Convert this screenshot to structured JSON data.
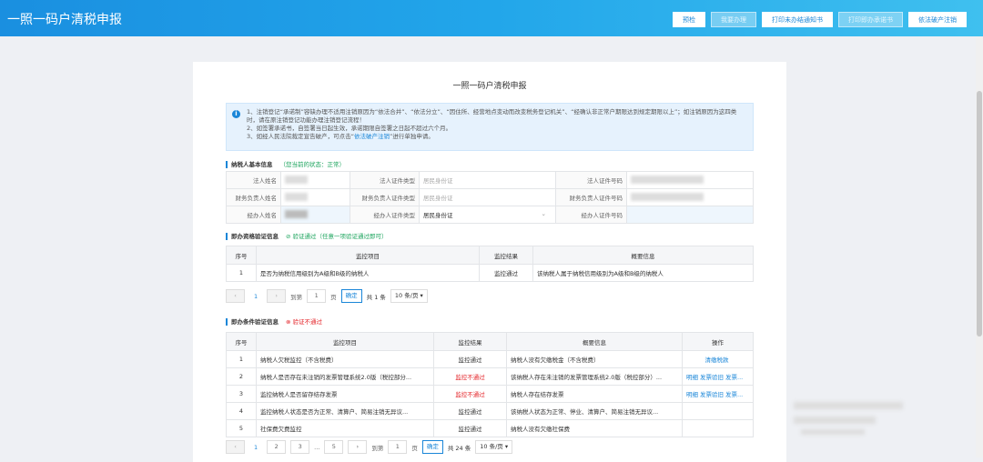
{
  "header": {
    "title": "一照一码户清税申报",
    "buttons": [
      {
        "label": "预检",
        "disabled": false
      },
      {
        "label": "我要办理",
        "disabled": true
      },
      {
        "label": "打印未办结通知书",
        "disabled": false
      },
      {
        "label": "打印即办承诺书",
        "disabled": true
      },
      {
        "label": "依法破产注销",
        "disabled": false
      }
    ]
  },
  "card": {
    "title": "一照一码户清税申报",
    "notice": {
      "line1": "1、注销登记“承诺制”容缺办理不适用注销原因为“依法合并”、“依法分立”、“因住所、经营地点变动而改变税务登记机关”、“经确认非正常户期限达到规定期限以上”；如注销原因为这四类时，请在原注销登记功能办理注销登记流程！",
      "line2": "2、如签署承诺书，自签署当日起生效，承诺期限自签署之日起不超过六个月。",
      "line3_pre": "3、如经人民法院裁定宣告破产，可点击“",
      "line3_link": "依法破产注销",
      "line3_post": "”进行单独申请。"
    },
    "basic": {
      "heading": "纳税人基本信息",
      "status": "（您当前的状态：正常）",
      "rows": [
        {
          "l1": "法人姓名",
          "l2": "法人证件类型",
          "v2": "居民身份证",
          "l3": "法人证件号码"
        },
        {
          "l1": "财务负责人姓名",
          "l2": "财务负责人证件类型",
          "v2": "居民身份证",
          "l3": "财务负责人证件号码"
        },
        {
          "l1": "经办人姓名",
          "l2": "经办人证件类型",
          "v2": "居民身份证",
          "l3": "经办人证件号码"
        }
      ]
    },
    "qual": {
      "heading": "即办资格验证信息",
      "status": "验证通过（任意一项验证通过即可）",
      "cols": [
        "序号",
        "监控项目",
        "监控结果",
        "概要信息"
      ],
      "rows": [
        [
          "1",
          "是否为纳税信用级别为A级和B级的纳税人",
          "监控通过",
          "该纳税人属于纳税信用级别为A级和B级的纳税人"
        ]
      ],
      "pager": {
        "current": "1",
        "goto_label": "到第",
        "goto_value": "1",
        "page_unit": "页",
        "confirm": "确定",
        "total": "共 1 条",
        "size": "10 条/页"
      }
    },
    "cond": {
      "heading": "即办条件验证信息",
      "status": "验证不通过",
      "cols": [
        "序号",
        "监控项目",
        "监控结果",
        "概要信息",
        "操作"
      ],
      "rows": [
        {
          "n": "1",
          "item": "纳税人欠税监控（不含税费）",
          "result": "监控通过",
          "pass": true,
          "info": "纳税人没有欠缴税金（不含税费）",
          "ops": [
            "清缴税款"
          ]
        },
        {
          "n": "2",
          "item": "纳税人是否存在未注销的发票管理系统2.0版（税控部分...",
          "result": "监控不通过",
          "pass": false,
          "info": "该纳税人存在未注销的发票管理系统2.0版（税控部分）...",
          "ops": [
            "明细",
            "发票验旧",
            "发票..."
          ]
        },
        {
          "n": "3",
          "item": "监控纳税人是否留存结存发票",
          "result": "监控不通过",
          "pass": false,
          "info": "纳税人存在结存发票",
          "ops": [
            "明细",
            "发票验旧",
            "发票..."
          ]
        },
        {
          "n": "4",
          "item": "监控纳税人状态是否为正常、清算户、简易注销无异议...",
          "result": "监控通过",
          "pass": true,
          "info": "该纳税人状态为正常、停业、清算户、简易注销无异议...",
          "ops": []
        },
        {
          "n": "5",
          "item": "社保费欠费监控",
          "result": "监控通过",
          "pass": true,
          "info": "纳税人没有欠缴社保费",
          "ops": []
        }
      ],
      "pager": {
        "current": "1",
        "pages": [
          "2",
          "3",
          "...",
          "5"
        ],
        "goto_label": "到第",
        "goto_value": "1",
        "page_unit": "页",
        "confirm": "确定",
        "total": "共 24 条",
        "size": "10 条/页"
      }
    }
  }
}
